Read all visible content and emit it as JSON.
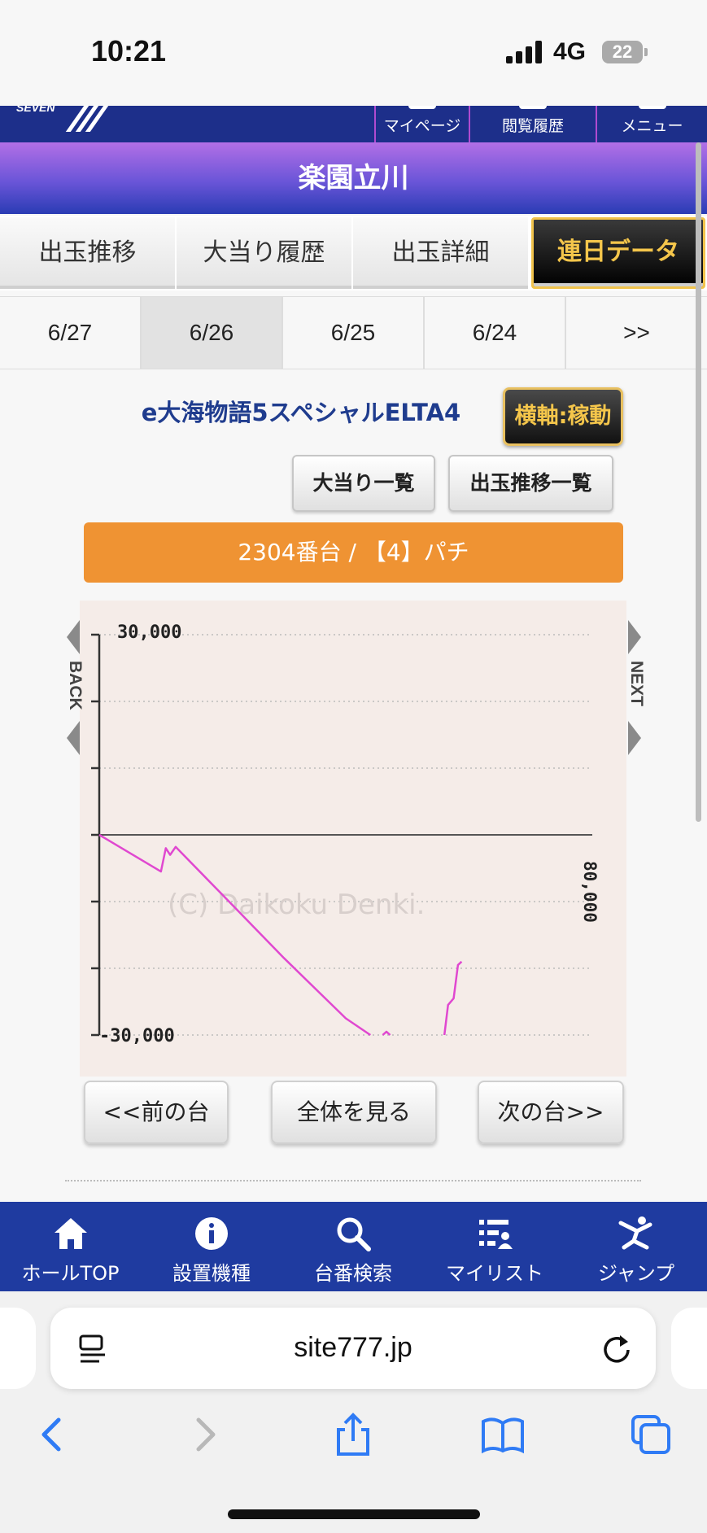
{
  "status": {
    "time": "10:21",
    "network": "4G",
    "battery": "22"
  },
  "header": {
    "buttons": [
      "マイページ",
      "閲覧履歴",
      "メニュー"
    ],
    "hall_name": "楽園立川"
  },
  "tabs": [
    {
      "label": "出玉推移",
      "active": false
    },
    {
      "label": "大当り履歴",
      "active": false
    },
    {
      "label": "出玉詳細",
      "active": false
    },
    {
      "label": "連日データ",
      "active": true
    }
  ],
  "dates": [
    {
      "label": "6/27",
      "selected": false
    },
    {
      "label": "6/26",
      "selected": true
    },
    {
      "label": "6/25",
      "selected": false
    },
    {
      "label": "6/24",
      "selected": false
    },
    {
      "label": ">>",
      "selected": false
    }
  ],
  "machine": {
    "name": "e大海物語5スペシャルELTA4",
    "axis_toggle": "横軸:稼動",
    "jackpot_list": "大当り一覧",
    "payout_list": "出玉推移一覧",
    "unit_banner": "2304番台 / 【4】パチ"
  },
  "chart_data": {
    "type": "line",
    "y_top_label": "30,000",
    "y_bottom_label": "-30,000",
    "ylim": [
      -30000,
      30000
    ],
    "xlim": [
      0,
      80000
    ],
    "x_right_label": "80,000",
    "watermark": "(C) Daikoku Denki.",
    "back_label": "BACK",
    "next_label": "NEXT",
    "grid": true,
    "line_color": "#e048d0",
    "series": [
      {
        "points": [
          [
            0,
            0
          ],
          [
            10000,
            -5500
          ],
          [
            10800,
            -2000
          ],
          [
            11500,
            -3000
          ],
          [
            12400,
            -1800
          ],
          [
            20000,
            -9000
          ],
          [
            30000,
            -18500
          ],
          [
            40000,
            -27500
          ],
          [
            44000,
            -30000
          ]
        ]
      },
      {
        "points": [
          [
            46000,
            -30000
          ],
          [
            46600,
            -29500
          ],
          [
            47200,
            -30000
          ]
        ]
      },
      {
        "points": [
          [
            56000,
            -30000
          ],
          [
            56600,
            -25500
          ],
          [
            57500,
            -24500
          ],
          [
            58200,
            -19500
          ],
          [
            58800,
            -19000
          ]
        ]
      }
    ]
  },
  "nav_buttons": {
    "prev": "<<前の台",
    "all": "全体を見る",
    "next": "次の台>>"
  },
  "bottom_nav": [
    {
      "label": "ホールTOP",
      "icon": "home-icon"
    },
    {
      "label": "設置機種",
      "icon": "info-icon"
    },
    {
      "label": "台番検索",
      "icon": "search-icon"
    },
    {
      "label": "マイリスト",
      "icon": "list-icon"
    },
    {
      "label": "ジャンプ",
      "icon": "jump-icon"
    }
  ],
  "browser": {
    "url": "site777.jp"
  }
}
